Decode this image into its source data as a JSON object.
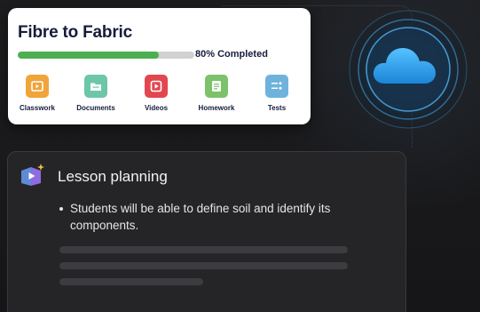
{
  "course": {
    "title": "Fibre to Fabric",
    "progress_fraction": 0.8,
    "progress_label": "80% Completed",
    "tiles": [
      {
        "label": "Classwork",
        "icon": "play-window-icon",
        "color": "#f0a43a"
      },
      {
        "label": "Documents",
        "icon": "folder-icon",
        "color": "#6cc7a8"
      },
      {
        "label": "Videos",
        "icon": "video-play-icon",
        "color": "#e2474f"
      },
      {
        "label": "Homework",
        "icon": "notebook-icon",
        "color": "#7cc26a"
      },
      {
        "label": "Tests",
        "icon": "checklist-icon",
        "color": "#6fb3dd"
      }
    ]
  },
  "cloud": {
    "icon": "cloud-icon",
    "color": "#2f9fe6"
  },
  "lesson": {
    "heading": "Lesson planning",
    "icon": "book-sparkle-icon",
    "objective": "Students will be able to define soil and identify its components."
  }
}
